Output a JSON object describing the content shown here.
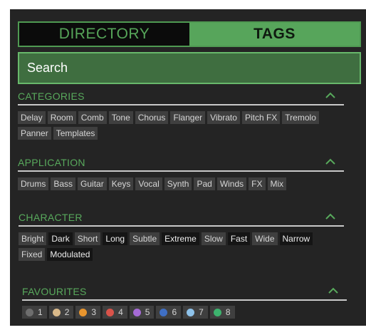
{
  "tabs": {
    "directory": "DIRECTORY",
    "tags": "TAGS"
  },
  "search": {
    "placeholder": "Search"
  },
  "categories": {
    "title": "CATEGORIES",
    "items": [
      "Delay",
      "Room",
      "Comb",
      "Tone",
      "Chorus",
      "Flanger",
      "Vibrato",
      "Pitch FX",
      "Tremolo",
      "Panner",
      "Templates"
    ]
  },
  "application": {
    "title": "APPLICATION",
    "items": [
      "Drums",
      "Bass",
      "Guitar",
      "Keys",
      "Vocal",
      "Synth",
      "Pad",
      "Winds",
      "FX",
      "Mix"
    ]
  },
  "character": {
    "title": "CHARACTER",
    "items": [
      "Bright",
      "Dark",
      "Short",
      "Long",
      "Subtle",
      "Extreme",
      "Slow",
      "Fast",
      "Wide",
      "Narrow",
      "Fixed",
      "Modulated"
    ]
  },
  "favourites": {
    "title": "FAVOURITES",
    "items": [
      {
        "label": "1",
        "color": "#6e6e6e"
      },
      {
        "label": "2",
        "color": "#d9b98a"
      },
      {
        "label": "3",
        "color": "#e8952e"
      },
      {
        "label": "4",
        "color": "#d9534a"
      },
      {
        "label": "5",
        "color": "#a66bd6"
      },
      {
        "label": "6",
        "color": "#3f6fc4"
      },
      {
        "label": "7",
        "color": "#8ec2ea"
      },
      {
        "label": "8",
        "color": "#3db36e"
      }
    ]
  },
  "colors": {
    "accent": "#57a55b",
    "panel": "#242424",
    "tag": "#3f3f3f"
  }
}
